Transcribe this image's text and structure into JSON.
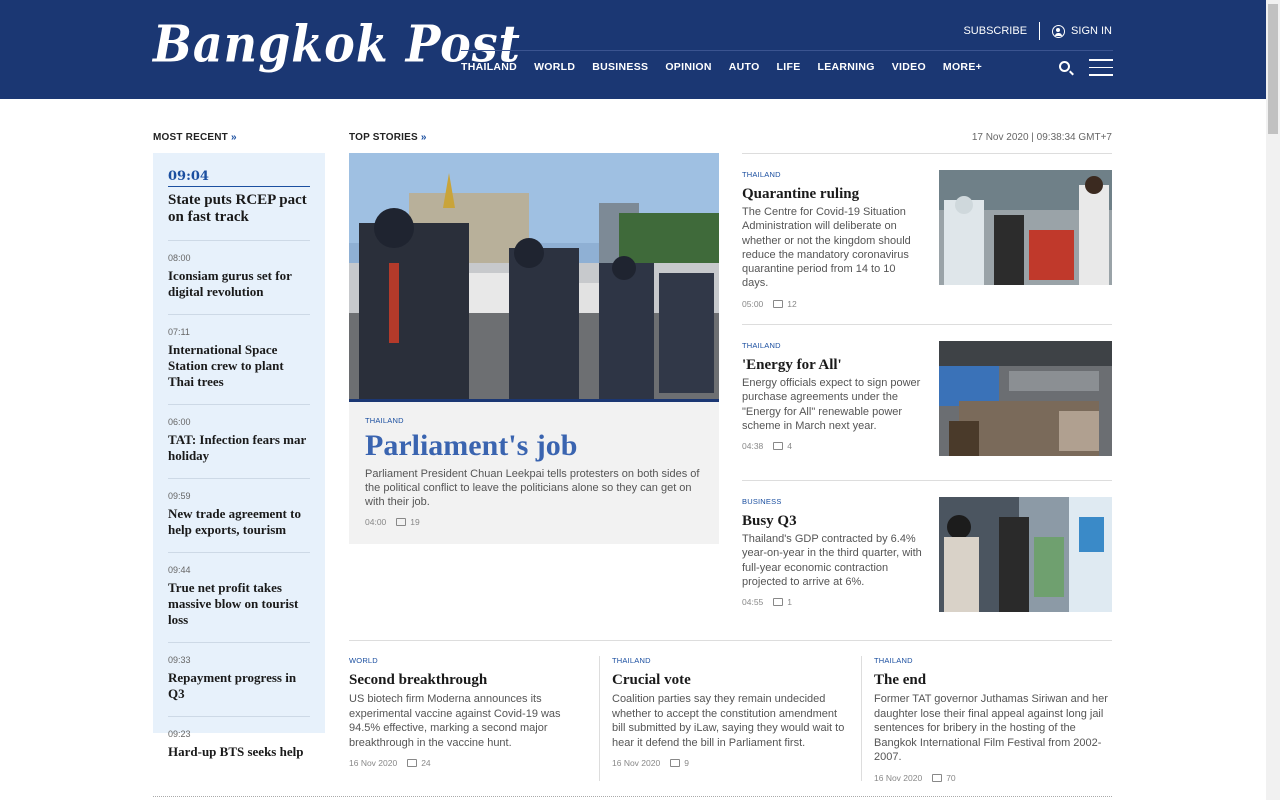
{
  "header": {
    "logo": "Bangkok Post",
    "subscribe": "SUBSCRIBE",
    "sign_in": "SIGN IN",
    "nav": [
      "THAILAND",
      "WORLD",
      "BUSINESS",
      "OPINION",
      "AUTO",
      "LIFE",
      "LEARNING",
      "VIDEO",
      "MORE+"
    ]
  },
  "sections": {
    "most_recent": "MOST RECENT",
    "top_stories": "TOP STORIES",
    "arrow": "»",
    "timestamp": "17 Nov 2020 | 09:38:34 GMT+7"
  },
  "recent": [
    {
      "time": "09:04",
      "title": "State puts RCEP pact on fast track"
    },
    {
      "time": "08:00",
      "title": "Iconsiam gurus set for digital revolution"
    },
    {
      "time": "07:11",
      "title": "International Space Station crew to plant Thai trees"
    },
    {
      "time": "06:00",
      "title": "TAT: Infection fears mar holiday"
    },
    {
      "time": "09:59",
      "title": "New trade agreement to help exports, tourism"
    },
    {
      "time": "09:44",
      "title": "True net profit takes massive blow on tourist loss"
    },
    {
      "time": "09:33",
      "title": "Repayment progress in Q3"
    },
    {
      "time": "09:23",
      "title": "Hard-up BTS seeks help"
    }
  ],
  "hero": {
    "category": "THAILAND",
    "title": "Parliament's job",
    "text": "Parliament President Chuan Leekpai tells protesters on both sides of the political conflict to leave the politicians alone so they can get on with their job.",
    "time": "04:00",
    "comments": "19"
  },
  "side_stories": [
    {
      "category": "THAILAND",
      "title": "Quarantine ruling",
      "text": "The Centre for Covid-19 Situation Administration will deliberate on whether or not the kingdom should reduce the mandatory coronavirus quarantine period from 14 to 10 days.",
      "time": "05:00",
      "comments": "12"
    },
    {
      "category": "THAILAND",
      "title": "'Energy for All'",
      "text": "Energy officials expect to sign power purchase agreements under the \"Energy for All\" renewable power scheme in March next year.",
      "time": "04:38",
      "comments": "4"
    },
    {
      "category": "BUSINESS",
      "title": "Busy Q3",
      "text": "Thailand's GDP contracted by 6.4% year-on-year in the third quarter, with full-year economic contraction projected to arrive at 6%.",
      "time": "04:55",
      "comments": "1"
    }
  ],
  "bottom_stories": [
    {
      "category": "WORLD",
      "title": "Second breakthrough",
      "text": "US biotech firm Moderna announces its experimental vaccine against Covid-19 was 94.5% effective, marking a second major breakthrough in the vaccine hunt.",
      "time": "16 Nov 2020",
      "comments": "24"
    },
    {
      "category": "THAILAND",
      "title": "Crucial vote",
      "text": "Coalition parties say they remain undecided whether to accept the constitution amendment bill submitted by iLaw, saying they would wait to hear it defend the bill in Parliament first.",
      "time": "16 Nov 2020",
      "comments": "9"
    },
    {
      "category": "THAILAND",
      "title": "The end",
      "text": "Former TAT governor Juthamas Siriwan and her daughter lose their final appeal against long jail sentences for bribery in the hosting of the Bangkok International Film Festival from 2002-2007.",
      "time": "16 Nov 2020",
      "comments": "70"
    }
  ]
}
